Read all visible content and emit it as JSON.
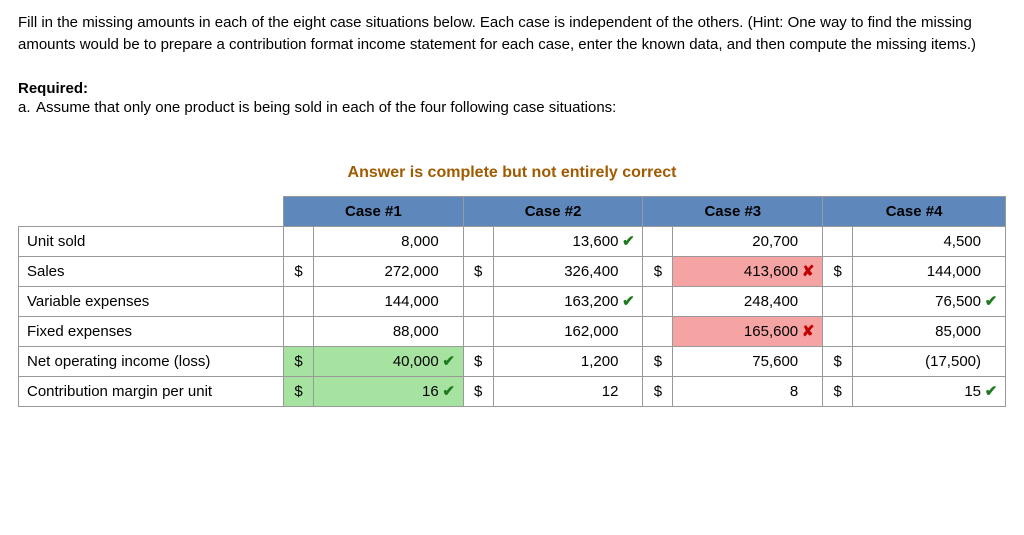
{
  "instructions": "Fill in the missing amounts in each of the eight case situations below. Each case is independent of the others. (Hint: One way to find the missing amounts would be to prepare a contribution format income statement for each case, enter the known data, and then compute the missing items.)",
  "required_label": "Required:",
  "req_a_letter": "a.",
  "req_a_text": "Assume that only one product is being sold in each of the four following case situations:",
  "banner": "Answer is complete but not entirely correct",
  "headers": {
    "c1": "Case #1",
    "c2": "Case #2",
    "c3": "Case #3",
    "c4": "Case #4"
  },
  "rows": {
    "unit_sold": {
      "label": "Unit sold",
      "c1": {
        "d": "",
        "v": "8,000"
      },
      "c2": {
        "d": "",
        "v": "13,600",
        "mark": "correct"
      },
      "c3": {
        "d": "",
        "v": "20,700"
      },
      "c4": {
        "d": "",
        "v": "4,500"
      }
    },
    "sales": {
      "label": "Sales",
      "c1": {
        "d": "$",
        "v": "272,000"
      },
      "c2": {
        "d": "$",
        "v": "326,400"
      },
      "c3": {
        "d": "$",
        "v": "413,600",
        "mark": "wrong"
      },
      "c4": {
        "d": "$",
        "v": "144,000"
      }
    },
    "var_exp": {
      "label": "Variable expenses",
      "c1": {
        "d": "",
        "v": "144,000"
      },
      "c2": {
        "d": "",
        "v": "163,200",
        "mark": "correct"
      },
      "c3": {
        "d": "",
        "v": "248,400"
      },
      "c4": {
        "d": "",
        "v": "76,500",
        "mark": "correct"
      }
    },
    "fixed_exp": {
      "label": "Fixed expenses",
      "c1": {
        "d": "",
        "v": "88,000"
      },
      "c2": {
        "d": "",
        "v": "162,000"
      },
      "c3": {
        "d": "",
        "v": "165,600",
        "mark": "wrong"
      },
      "c4": {
        "d": "",
        "v": "85,000"
      }
    },
    "noi": {
      "label": "Net operating income (loss)",
      "c1": {
        "d": "$",
        "dgiven": true,
        "v": "40,000",
        "given": true,
        "mark": "correct"
      },
      "c2": {
        "d": "$",
        "v": "1,200"
      },
      "c3": {
        "d": "$",
        "v": "75,600"
      },
      "c4": {
        "d": "$",
        "v": "(17,500)"
      }
    },
    "cmu": {
      "label": "Contribution margin per unit",
      "c1": {
        "d": "$",
        "dgiven": true,
        "v": "16",
        "given": true,
        "mark": "correct"
      },
      "c2": {
        "d": "$",
        "v": "12"
      },
      "c3": {
        "d": "$",
        "v": "8"
      },
      "c4": {
        "d": "$",
        "v": "15",
        "mark": "correct"
      }
    }
  },
  "marks": {
    "correct": "✔",
    "wrong": "✘"
  }
}
